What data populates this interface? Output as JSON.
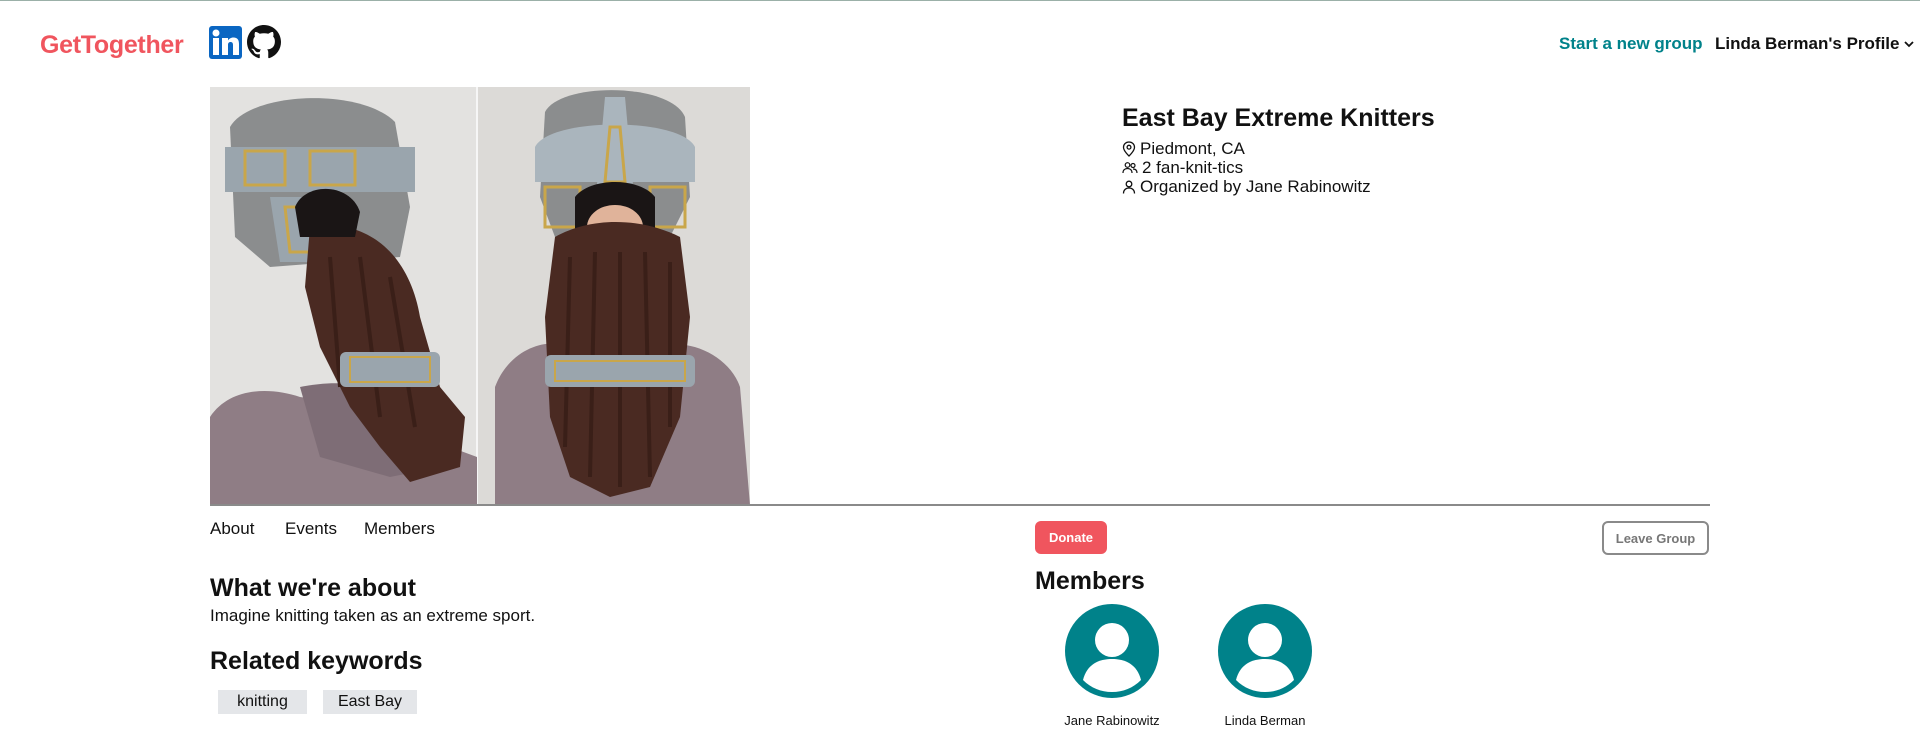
{
  "header": {
    "logo": "GetTogether",
    "start_group": "Start a new group",
    "profile": "Linda Berman's Profile",
    "social_icons": [
      "linkedin-icon",
      "github-icon"
    ]
  },
  "group": {
    "name": "East Bay Extreme Knitters",
    "location": "Piedmont, CA",
    "member_count": "2 fan-knit-tics",
    "organizer": "Organized by Jane Rabinowitz"
  },
  "tabs": [
    "About",
    "Events",
    "Members"
  ],
  "actions": {
    "donate": "Donate",
    "leave": "Leave Group"
  },
  "about": {
    "heading": "What we're about",
    "text": "Imagine knitting taken as an extreme sport."
  },
  "keywords": {
    "heading": "Related keywords",
    "items": [
      "knitting",
      "East Bay"
    ]
  },
  "members": {
    "heading": "Members",
    "list": [
      {
        "name": "Jane Rabinowitz"
      },
      {
        "name": "Linda Berman"
      }
    ]
  },
  "colors": {
    "brand": "#f0555e",
    "accent": "#00828a",
    "keyword_bg": "#e4e6e9"
  }
}
